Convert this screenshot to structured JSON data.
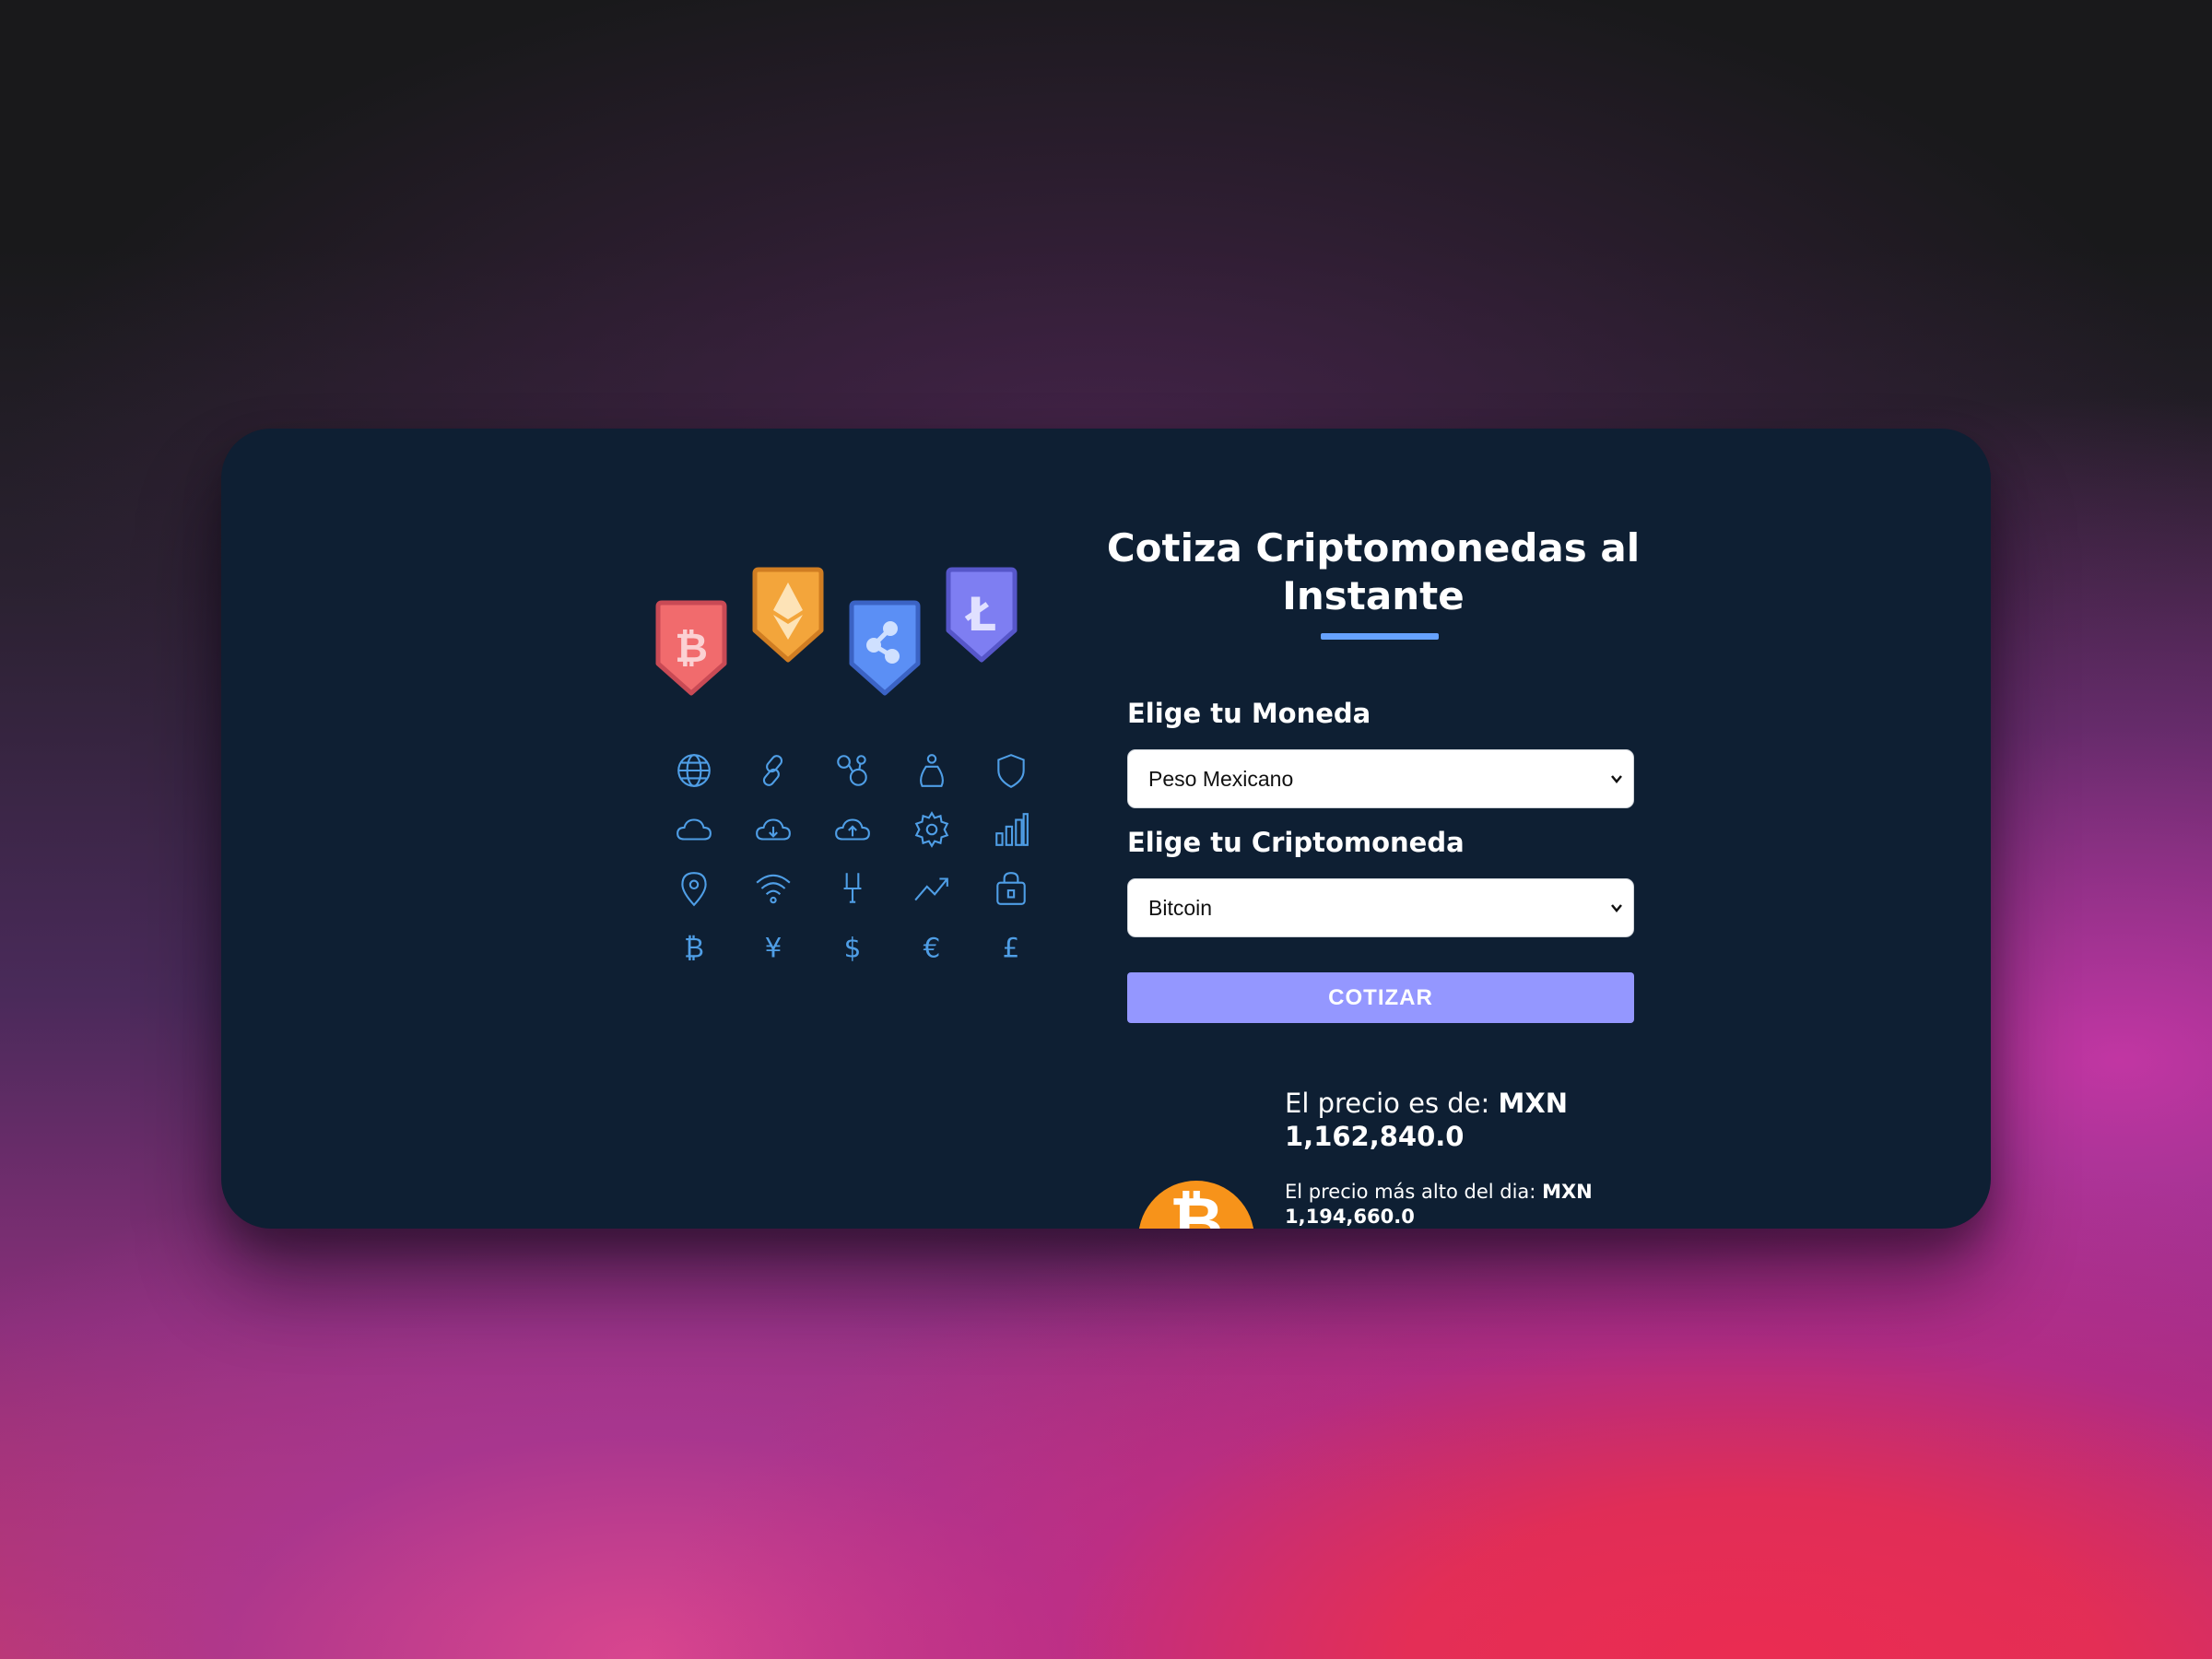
{
  "header": {
    "title": "Cotiza Criptomonedas al Instante"
  },
  "form": {
    "currency_label": "Elige tu Moneda",
    "currency_selected": "Peso Mexicano",
    "crypto_label": "Elige tu Criptomoneda",
    "crypto_selected": "Bitcoin",
    "submit_label": "COTIZAR"
  },
  "result": {
    "price_label": "El precio es de:",
    "price_value": "MXN 1,162,840.0",
    "high_label": "El precio más alto del dia:",
    "high_value": "MXN 1,194,660.0"
  },
  "illustration": {
    "badges": [
      {
        "icon": "bitcoin-badge-icon",
        "color": "#f16b6d"
      },
      {
        "icon": "ethereum-badge-icon",
        "color": "#f3a53b"
      },
      {
        "icon": "ripple-badge-icon",
        "color": "#5b8ff5"
      },
      {
        "icon": "litecoin-badge-icon",
        "color": "#7e7ef2"
      }
    ],
    "grid_icons": [
      "globe-icon",
      "link-icon",
      "nodes-icon",
      "money-bag-icon",
      "shield-icon",
      "cloud-icon",
      "cloud-download-icon",
      "cloud-upload-icon",
      "gear-icon",
      "bar-chart-icon",
      "location-pin-icon",
      "wifi-icon",
      "plug-icon",
      "trend-up-icon",
      "lock-bag-icon",
      "bitcoin-icon",
      "yen-icon",
      "dollar-icon",
      "euro-icon",
      "pound-icon"
    ],
    "icon_color": "#4f9ee6"
  },
  "colors": {
    "card_background": "#0e1f33",
    "accent_underline": "#66a2fe",
    "button": "#9497ff",
    "coin": "#f7931a"
  }
}
